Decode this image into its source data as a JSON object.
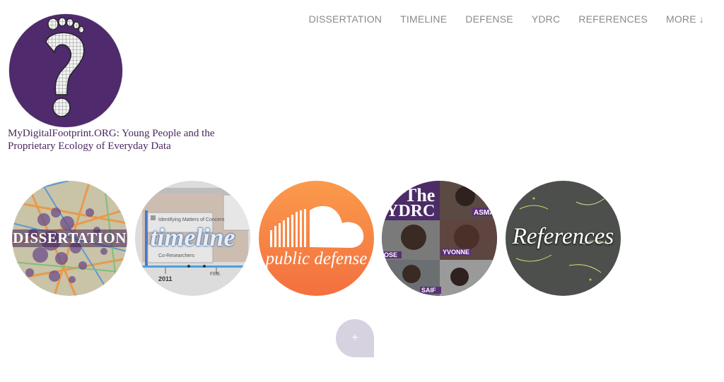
{
  "nav": {
    "items": [
      {
        "label": "DISSERTATION"
      },
      {
        "label": "TIMELINE"
      },
      {
        "label": "DEFENSE"
      },
      {
        "label": "YDRC"
      },
      {
        "label": "REFERENCES"
      }
    ],
    "more_label": "MORE",
    "more_arrow": "↓"
  },
  "site": {
    "title": "MyDigitalFootprint.ORG: Young People and the Proprietary Ecology of Everyday Data",
    "logo_icon": "question-mark-footprint-icon"
  },
  "tiles": [
    {
      "label": "DISSERTATION",
      "icon": "map-dots-image"
    },
    {
      "label": "timeline",
      "sublabels": [
        "Identifying Matters of Concern",
        "Co-Researchers",
        "2011",
        "FEB."
      ],
      "icon": "timeline-image"
    },
    {
      "label": "public defense",
      "icon": "soundcloud-icon"
    },
    {
      "label_the": "The",
      "label_abbr": "YDRC",
      "names": [
        "ASMA",
        "YVONNE",
        "OSE",
        "SAIF"
      ],
      "icon": "youth-photos-image"
    },
    {
      "label": "References",
      "icon": "chalkboard-words-image"
    }
  ],
  "add_button": {
    "label": "+"
  },
  "colors": {
    "brand_purple": "#4f2a6d",
    "nav_gray": "#8a8a8a",
    "soundcloud_orange": "#f77e42"
  }
}
